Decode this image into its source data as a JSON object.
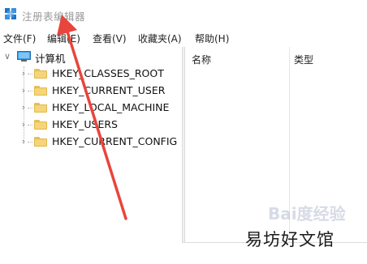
{
  "window": {
    "title": "注册表编辑器",
    "icon": "regedit-icon"
  },
  "menu": [
    {
      "label": "文件(F)"
    },
    {
      "label": "编辑(E)"
    },
    {
      "label": "查看(V)"
    },
    {
      "label": "收藏夹(A)"
    },
    {
      "label": "帮助(H)"
    }
  ],
  "tree": {
    "root": {
      "label": "计算机",
      "expanded": true
    },
    "items": [
      {
        "label": "HKEY_CLASSES_ROOT"
      },
      {
        "label": "HKEY_CURRENT_USER"
      },
      {
        "label": "HKEY_LOCAL_MACHINE"
      },
      {
        "label": "HKEY_USERS"
      },
      {
        "label": "HKEY_CURRENT_CONFIG"
      }
    ]
  },
  "list": {
    "columns": [
      {
        "label": "名称"
      },
      {
        "label": "类型"
      }
    ]
  },
  "overlay": {
    "watermark": "Bai度经验",
    "site": "易坊好文馆",
    "arrow_color": "#e8453c"
  },
  "colors": {
    "folder": "#f6d47a",
    "menu_text": "#222222",
    "title_text": "#9a9a9a"
  }
}
